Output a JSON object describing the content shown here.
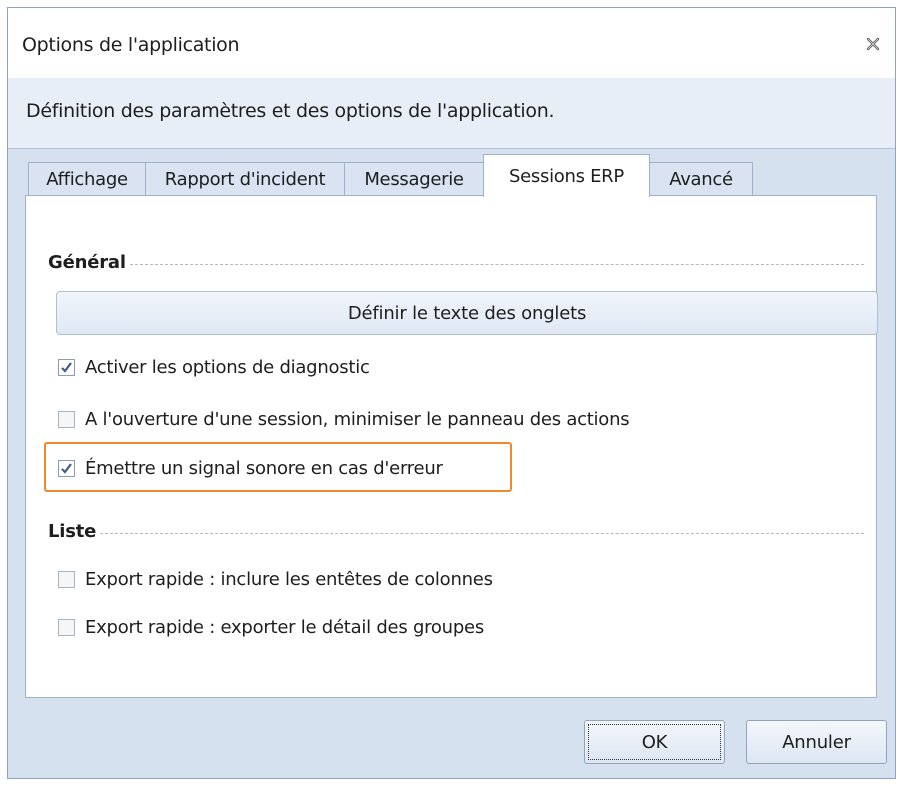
{
  "window": {
    "title": "Options de l'application",
    "close_icon": "close-icon"
  },
  "description": "Définition des paramètres et des options de l'application.",
  "tabs": [
    {
      "label": "Affichage",
      "active": false
    },
    {
      "label": "Rapport d'incident",
      "active": false
    },
    {
      "label": "Messagerie",
      "active": false
    },
    {
      "label": "Sessions ERP",
      "active": true
    },
    {
      "label": "Avancé",
      "active": false
    }
  ],
  "general": {
    "title": "Général",
    "define_tabs_button": "Définir le texte des onglets",
    "options": [
      {
        "label": "Activer les options de diagnostic",
        "checked": true
      },
      {
        "label": "A l'ouverture d'une session, minimiser le panneau des actions",
        "checked": false
      },
      {
        "label": "Émettre un signal sonore en cas d'erreur",
        "checked": true
      }
    ]
  },
  "list": {
    "title": "Liste",
    "options": [
      {
        "label": "Export rapide : inclure les entêtes de colonnes",
        "checked": false
      },
      {
        "label": "Export rapide : exporter le détail des groupes",
        "checked": false
      }
    ]
  },
  "buttons": {
    "ok": "OK",
    "cancel": "Annuler"
  },
  "colors": {
    "highlight": "#f0892e",
    "window_bg": "#d6e1f0"
  }
}
